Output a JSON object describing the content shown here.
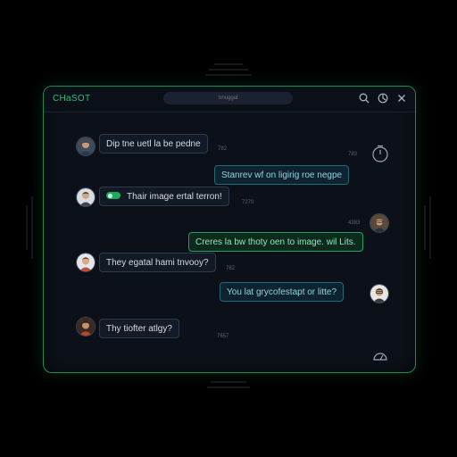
{
  "header": {
    "app_title": "CHaSOT",
    "search_placeholder": "Snuggat"
  },
  "icons": {
    "search": "search-icon",
    "settings": "settings-icon",
    "close": "close-icon",
    "timer": "timer-icon",
    "dashboard": "gauge-icon"
  },
  "colors": {
    "accent_green": "#28c275",
    "border_green": "#1f8a52",
    "outgoing_teal": "#1e6a78",
    "background": "#0c1119"
  },
  "messages": [
    {
      "direction": "incoming",
      "text": "Dip tne uetl la be pedne",
      "time": "782"
    },
    {
      "direction": "outgoing",
      "text": "Stanrev wf on ligirig roe negpe",
      "time": "783"
    },
    {
      "direction": "incoming",
      "text": "Thair image ertal terron!",
      "time": "7270"
    },
    {
      "direction": "outgoing",
      "text": "Creres la bw thoty oen to image. wil Lits.",
      "time": "4383"
    },
    {
      "direction": "incoming",
      "text": "They egatal hami tnvooy?",
      "time": "782"
    },
    {
      "direction": "outgoing",
      "text": "You lat grycofestapt or litte?",
      "time": ""
    },
    {
      "direction": "incoming",
      "text": "Thy tiofter atlgy?",
      "time": "7657"
    }
  ]
}
